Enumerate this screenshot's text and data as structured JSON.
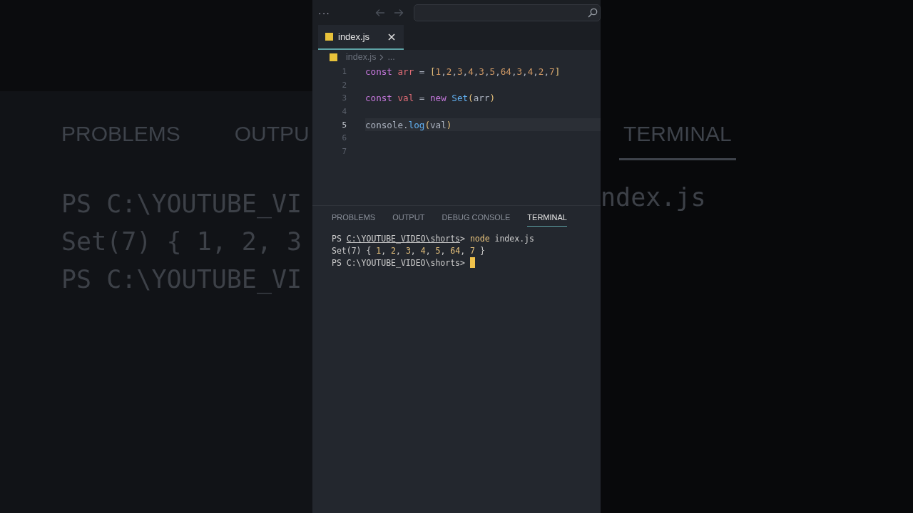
{
  "background": {
    "left": {
      "tabs": [
        "PROBLEMS",
        "OUTPU"
      ],
      "lines": [
        "PS C:\\YOUTUBE_VI",
        "Set(7) { 1, 2, 3",
        "PS C:\\YOUTUBE_VI"
      ]
    },
    "right": {
      "tab": "TERMINAL",
      "lines": [
        "ndex.js"
      ]
    }
  },
  "title_bar": {
    "menu": "···"
  },
  "editor_tabs": [
    {
      "label": "index.js",
      "selected": true
    }
  ],
  "breadcrumb": [
    "index.js",
    "..."
  ],
  "code_lines": [
    {
      "number": "1",
      "current": false,
      "tokens": [
        {
          "kind": "keyword",
          "text": "const "
        },
        {
          "kind": "variable",
          "text": "arr"
        },
        {
          "kind": "plain",
          "text": " = "
        },
        {
          "kind": "bracket",
          "text": "["
        },
        {
          "kind": "number",
          "text": "1"
        },
        {
          "kind": "plain",
          "text": ","
        },
        {
          "kind": "number",
          "text": "2"
        },
        {
          "kind": "plain",
          "text": ","
        },
        {
          "kind": "number",
          "text": "3"
        },
        {
          "kind": "plain",
          "text": ","
        },
        {
          "kind": "number",
          "text": "4"
        },
        {
          "kind": "plain",
          "text": ","
        },
        {
          "kind": "number",
          "text": "3"
        },
        {
          "kind": "plain",
          "text": ","
        },
        {
          "kind": "number",
          "text": "5"
        },
        {
          "kind": "plain",
          "text": ","
        },
        {
          "kind": "number",
          "text": "64"
        },
        {
          "kind": "plain",
          "text": ","
        },
        {
          "kind": "number",
          "text": "3"
        },
        {
          "kind": "plain",
          "text": ","
        },
        {
          "kind": "number",
          "text": "4"
        },
        {
          "kind": "plain",
          "text": ","
        },
        {
          "kind": "number",
          "text": "2"
        },
        {
          "kind": "plain",
          "text": ","
        },
        {
          "kind": "number",
          "text": "7"
        },
        {
          "kind": "bracket",
          "text": "]"
        }
      ]
    },
    {
      "number": "2",
      "current": false
    },
    {
      "number": "3",
      "current": false,
      "tokens": [
        {
          "kind": "keyword",
          "text": "const "
        },
        {
          "kind": "variable",
          "text": "val"
        },
        {
          "kind": "plain",
          "text": " = "
        },
        {
          "kind": "keyword",
          "text": "new "
        },
        {
          "kind": "class",
          "text": "Set"
        },
        {
          "kind": "bracket",
          "text": "("
        },
        {
          "kind": "plain",
          "text": "arr"
        },
        {
          "kind": "bracket",
          "text": ")"
        }
      ]
    },
    {
      "number": "4",
      "current": false
    },
    {
      "number": "5",
      "current": true,
      "tokens": [
        {
          "kind": "plain",
          "text": "console."
        },
        {
          "kind": "function",
          "text": "log"
        },
        {
          "kind": "bracket",
          "text": "("
        },
        {
          "kind": "plain",
          "text": "val"
        },
        {
          "kind": "bracket",
          "text": ")"
        }
      ]
    },
    {
      "number": "6",
      "current": false
    },
    {
      "number": "7",
      "current": false
    }
  ],
  "panel_tabs": [
    {
      "label": "PROBLEMS",
      "selected": false
    },
    {
      "label": "OUTPUT",
      "selected": false
    },
    {
      "label": "DEBUG CONSOLE",
      "selected": false
    },
    {
      "label": "TERMINAL",
      "selected": true
    }
  ],
  "terminal_lines": [
    {
      "cursor": false,
      "segments": [
        {
          "kind": "plain",
          "text": "PS "
        },
        {
          "kind": "link",
          "text": "C:\\YOUTUBE_VIDEO\\shorts"
        },
        {
          "kind": "plain",
          "text": "> "
        },
        {
          "kind": "command",
          "text": "node"
        },
        {
          "kind": "plain",
          "text": " index.js"
        }
      ]
    },
    {
      "cursor": false,
      "segments": [
        {
          "kind": "plain",
          "text": "Set(7) { "
        },
        {
          "kind": "number",
          "text": "1"
        },
        {
          "kind": "plain",
          "text": ", "
        },
        {
          "kind": "number",
          "text": "2"
        },
        {
          "kind": "plain",
          "text": ", "
        },
        {
          "kind": "number",
          "text": "3"
        },
        {
          "kind": "plain",
          "text": ", "
        },
        {
          "kind": "number",
          "text": "4"
        },
        {
          "kind": "plain",
          "text": ", "
        },
        {
          "kind": "number",
          "text": "5"
        },
        {
          "kind": "plain",
          "text": ", "
        },
        {
          "kind": "number",
          "text": "64"
        },
        {
          "kind": "plain",
          "text": ", "
        },
        {
          "kind": "number",
          "text": "7"
        },
        {
          "kind": "plain",
          "text": " }"
        }
      ]
    },
    {
      "cursor": true,
      "segments": [
        {
          "kind": "plain",
          "text": "PS C:\\YOUTUBE_VIDEO\\shorts> "
        }
      ]
    }
  ]
}
